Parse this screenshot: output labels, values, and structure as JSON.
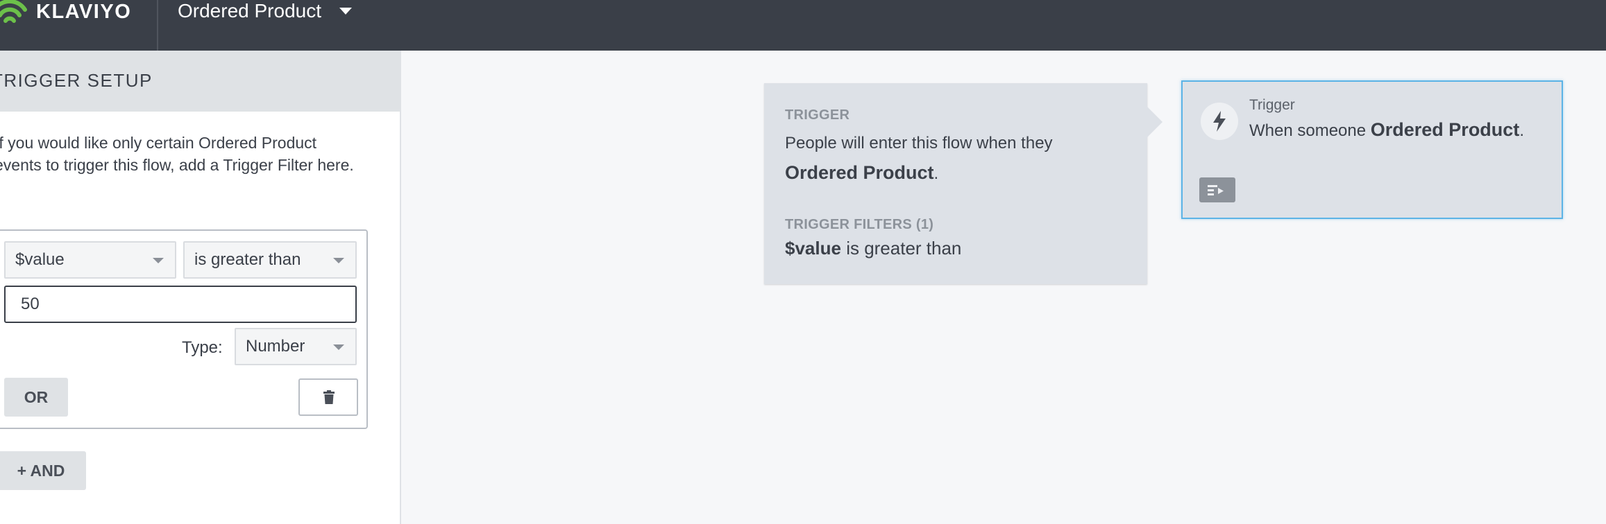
{
  "header": {
    "brand": "KLAVIYO",
    "trigger_name": "Ordered Product",
    "icons": {
      "logo": "klaviyo-wifi-logo",
      "dropdown": "caret-down-icon"
    },
    "colors": {
      "bar": "#3a3f48",
      "logo_green": "#6cc04a"
    }
  },
  "sidebar": {
    "title": "TRIGGER SETUP",
    "intro": "If you would like only certain Ordered Product events to trigger this flow, add a Trigger Filter here.",
    "filter": {
      "property": "$value",
      "operator": "is greater than",
      "value": "50",
      "type_label": "Type:",
      "type": "Number",
      "or_label": "OR",
      "delete_icon": "trash-icon"
    },
    "and_label": "+ AND"
  },
  "summary": {
    "heading": "TRIGGER",
    "text_prefix": "People will enter this flow when they",
    "metric": "Ordered Product",
    "suffix": ".",
    "filters_heading": "TRIGGER FILTERS (1)",
    "filter_property": "$value",
    "filter_operator": "is greater than"
  },
  "trigger_node": {
    "label": "Trigger",
    "text_prefix": "When someone",
    "metric": "Ordered Product",
    "suffix": ".",
    "icons": {
      "main": "lightning-bolt-icon",
      "action": "details-panel-icon"
    },
    "colors": {
      "border": "#5cb3e6"
    }
  }
}
